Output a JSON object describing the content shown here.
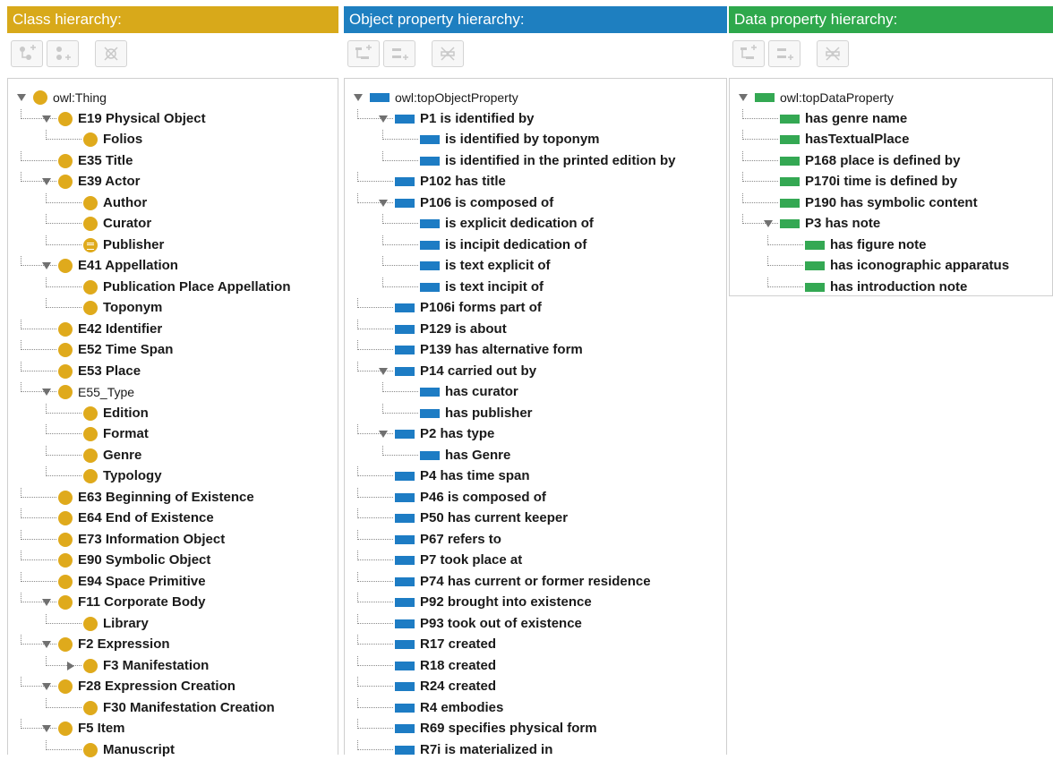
{
  "class_panel": {
    "title": "Class hierarchy:",
    "toolbar": [
      "add-subclass-icon",
      "add-sibling-class-icon",
      "delete-class-icon"
    ],
    "tree": [
      {
        "label": "owl:Thing",
        "depth": 0,
        "toggle": "open",
        "root": true
      },
      {
        "label": "E19 Physical Object",
        "depth": 1,
        "toggle": "open"
      },
      {
        "label": "Folios",
        "depth": 2
      },
      {
        "label": "E35 Title",
        "depth": 1
      },
      {
        "label": "E39 Actor",
        "depth": 1,
        "toggle": "open"
      },
      {
        "label": "Author",
        "depth": 2
      },
      {
        "label": "Curator",
        "depth": 2
      },
      {
        "label": "Publisher",
        "depth": 2,
        "icon": "defined-class-icon"
      },
      {
        "label": "E41 Appellation",
        "depth": 1,
        "toggle": "open"
      },
      {
        "label": "Publication Place Appellation",
        "depth": 2
      },
      {
        "label": "Toponym",
        "depth": 2
      },
      {
        "label": "E42 Identifier",
        "depth": 1
      },
      {
        "label": "E52 Time Span",
        "depth": 1
      },
      {
        "label": "E53 Place",
        "depth": 1
      },
      {
        "label": "E55_Type",
        "depth": 1,
        "toggle": "open",
        "plain": true
      },
      {
        "label": "Edition",
        "depth": 2
      },
      {
        "label": "Format",
        "depth": 2
      },
      {
        "label": "Genre",
        "depth": 2
      },
      {
        "label": "Typology",
        "depth": 2
      },
      {
        "label": "E63 Beginning of Existence",
        "depth": 1
      },
      {
        "label": "E64 End of Existence",
        "depth": 1
      },
      {
        "label": "E73 Information Object",
        "depth": 1
      },
      {
        "label": "E90 Symbolic Object",
        "depth": 1
      },
      {
        "label": "E94 Space Primitive",
        "depth": 1
      },
      {
        "label": "F11 Corporate Body",
        "depth": 1,
        "toggle": "open"
      },
      {
        "label": "Library",
        "depth": 2
      },
      {
        "label": "F2 Expression",
        "depth": 1,
        "toggle": "open"
      },
      {
        "label": "F3 Manifestation",
        "depth": 2,
        "toggle": "closed"
      },
      {
        "label": "F28 Expression Creation",
        "depth": 1,
        "toggle": "open"
      },
      {
        "label": "F30 Manifestation Creation",
        "depth": 2
      },
      {
        "label": "F5 Item",
        "depth": 1,
        "toggle": "open"
      },
      {
        "label": "Manuscript",
        "depth": 2
      }
    ]
  },
  "object_panel": {
    "title": "Object property hierarchy:",
    "toolbar": [
      "add-sub-property-icon",
      "add-sibling-property-icon",
      "delete-property-icon"
    ],
    "tree": [
      {
        "label": "owl:topObjectProperty",
        "depth": 0,
        "toggle": "open",
        "root": true
      },
      {
        "label": "P1 is identified by",
        "depth": 1,
        "toggle": "open"
      },
      {
        "label": "is identified by toponym",
        "depth": 2
      },
      {
        "label": "is identified in the printed edition by",
        "depth": 2
      },
      {
        "label": "P102 has title",
        "depth": 1
      },
      {
        "label": "P106 is composed of",
        "depth": 1,
        "toggle": "open"
      },
      {
        "label": "is explicit dedication of",
        "depth": 2
      },
      {
        "label": "is incipit dedication of",
        "depth": 2
      },
      {
        "label": "is text explicit of",
        "depth": 2
      },
      {
        "label": "is text incipit of",
        "depth": 2
      },
      {
        "label": "P106i forms part of",
        "depth": 1
      },
      {
        "label": "P129 is about",
        "depth": 1
      },
      {
        "label": "P139 has alternative form",
        "depth": 1
      },
      {
        "label": "P14 carried out by",
        "depth": 1,
        "toggle": "open"
      },
      {
        "label": "has curator",
        "depth": 2
      },
      {
        "label": "has publisher",
        "depth": 2
      },
      {
        "label": "P2 has type",
        "depth": 1,
        "toggle": "open"
      },
      {
        "label": "has Genre",
        "depth": 2
      },
      {
        "label": "P4 has time span",
        "depth": 1
      },
      {
        "label": "P46 is composed of",
        "depth": 1
      },
      {
        "label": "P50 has current keeper",
        "depth": 1
      },
      {
        "label": "P67 refers to",
        "depth": 1
      },
      {
        "label": "P7 took place at",
        "depth": 1
      },
      {
        "label": "P74 has current or former residence",
        "depth": 1
      },
      {
        "label": "P92 brought into existence",
        "depth": 1
      },
      {
        "label": "P93 took out of existence",
        "depth": 1
      },
      {
        "label": "R17 created",
        "depth": 1
      },
      {
        "label": "R18 created",
        "depth": 1
      },
      {
        "label": "R24 created",
        "depth": 1
      },
      {
        "label": "R4 embodies",
        "depth": 1
      },
      {
        "label": "R69 specifies physical form",
        "depth": 1
      },
      {
        "label": "R7i is materialized in",
        "depth": 1
      }
    ]
  },
  "data_panel": {
    "title": "Data property hierarchy:",
    "toolbar": [
      "add-sub-property-icon",
      "add-sibling-property-icon",
      "delete-property-icon"
    ],
    "tree": [
      {
        "label": "owl:topDataProperty",
        "depth": 0,
        "toggle": "open",
        "root": true
      },
      {
        "label": "has genre name",
        "depth": 1
      },
      {
        "label": "hasTextualPlace",
        "depth": 1
      },
      {
        "label": "P168 place is defined by",
        "depth": 1
      },
      {
        "label": "P170i time is defined by",
        "depth": 1
      },
      {
        "label": "P190 has symbolic content",
        "depth": 1
      },
      {
        "label": "P3 has note",
        "depth": 1,
        "toggle": "open"
      },
      {
        "label": "has figure note",
        "depth": 2
      },
      {
        "label": "has iconographic apparatus",
        "depth": 2
      },
      {
        "label": "has introduction note",
        "depth": 2
      }
    ]
  },
  "colors": {
    "class_header": "#d8a91a",
    "object_header": "#1e7fc0",
    "data_header": "#2ea84c",
    "class_icon": "#dfaa1c",
    "object_icon": "#1d7cc4",
    "data_icon": "#34a853"
  }
}
